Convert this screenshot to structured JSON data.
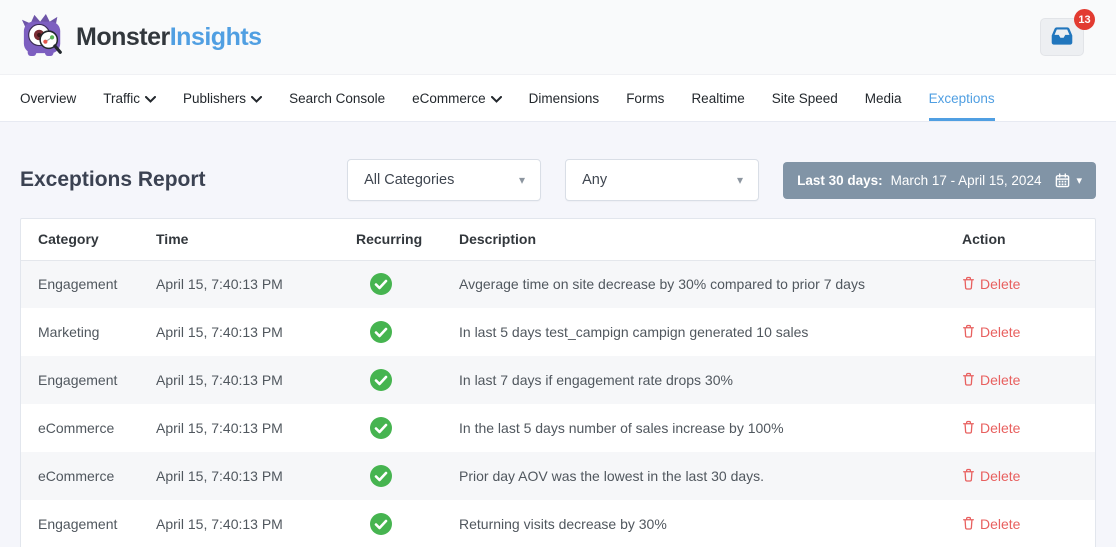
{
  "header": {
    "brand": {
      "name_primary": "Monster",
      "name_secondary": "Insights"
    },
    "notifications": {
      "count": "13"
    }
  },
  "nav": {
    "items": [
      {
        "label": "Overview"
      },
      {
        "label": "Traffic",
        "dropdown": true
      },
      {
        "label": "Publishers",
        "dropdown": true
      },
      {
        "label": "Search Console"
      },
      {
        "label": "eCommerce",
        "dropdown": true
      },
      {
        "label": "Dimensions"
      },
      {
        "label": "Forms"
      },
      {
        "label": "Realtime"
      },
      {
        "label": "Site Speed"
      },
      {
        "label": "Media"
      },
      {
        "label": "Exceptions",
        "active": true
      }
    ]
  },
  "report": {
    "title": "Exceptions Report",
    "filters": {
      "category_filter": {
        "value": "All Categories"
      },
      "type_filter": {
        "value": "Any"
      },
      "date_range": {
        "label": "Last 30 days:",
        "range": "March 17 - April 15, 2024"
      }
    }
  },
  "table": {
    "columns": [
      "Category",
      "Time",
      "Recurring",
      "Description",
      "Action"
    ],
    "delete_label": "Delete",
    "rows": [
      {
        "category": "Engagement",
        "time": "April 15, 7:40:13 PM",
        "recurring": true,
        "description": "Avgerage time on site decrease by 30% compared to prior 7 days"
      },
      {
        "category": "Marketing",
        "time": "April 15, 7:40:13 PM",
        "recurring": true,
        "description": "In last 5 days test_campign campign generated 10 sales"
      },
      {
        "category": "Engagement",
        "time": "April 15, 7:40:13 PM",
        "recurring": true,
        "description": "In last 7 days if engagement rate drops 30%"
      },
      {
        "category": "eCommerce",
        "time": "April 15, 7:40:13 PM",
        "recurring": true,
        "description": "In the last 5 days number of sales increase by 100%"
      },
      {
        "category": "eCommerce",
        "time": "April 15, 7:40:13 PM",
        "recurring": true,
        "description": "Prior day AOV was the lowest in the last 30 days."
      },
      {
        "category": "Engagement",
        "time": "April 15, 7:40:13 PM",
        "recurring": true,
        "description": "Returning visits decrease by 30%"
      }
    ]
  },
  "colors": {
    "accent_blue": "#509fe2",
    "date_button_bg": "#8194a6",
    "success_green": "#46b450",
    "delete_red": "#e8605f",
    "badge_red": "#e23b31"
  }
}
